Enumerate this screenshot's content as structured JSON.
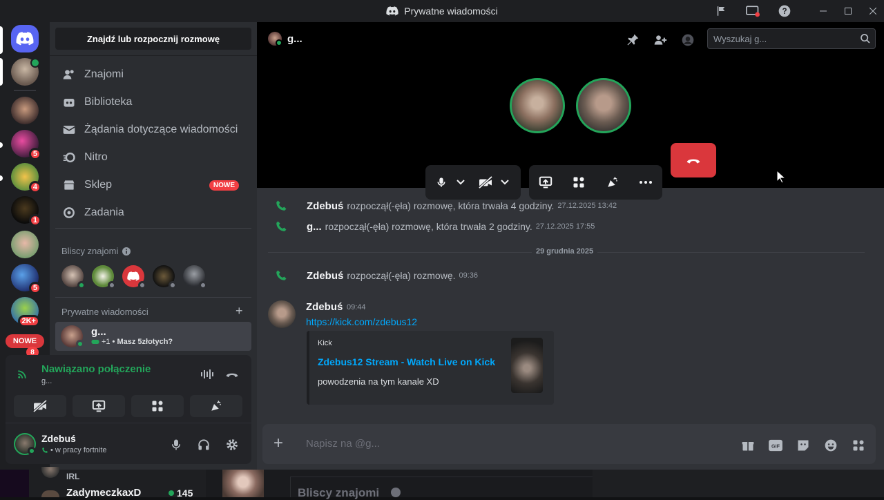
{
  "window": {
    "title": "Prywatne wiadomości"
  },
  "rail": {
    "badges": [
      "5",
      "4",
      "1",
      "5",
      "2K+"
    ],
    "new_label": "NOWE",
    "new_count": "8"
  },
  "sidebar": {
    "search_label": "Znajdź lub rozpocznij rozmowę",
    "nav": [
      {
        "label": "Znajomi",
        "icon": "friends-icon"
      },
      {
        "label": "Biblioteka",
        "icon": "library-icon"
      },
      {
        "label": "Żądania dotyczące wiadomości",
        "icon": "mail-icon"
      },
      {
        "label": "Nitro",
        "icon": "nitro-icon"
      },
      {
        "label": "Sklep",
        "icon": "shop-icon",
        "badge": "NOWE"
      },
      {
        "label": "Zadania",
        "icon": "quests-icon"
      }
    ],
    "close_friends_header": "Bliscy znajomi",
    "dm_header": "Prywatne wiadomości",
    "dm_item": {
      "name": "g...",
      "status_prefix": "+1",
      "status": "• Masz 5złotych?"
    }
  },
  "voice": {
    "status": "Nawiązano połączenie",
    "channel": "g..."
  },
  "user": {
    "name": "Zdebuś",
    "status": "• w pracy fortnite"
  },
  "header": {
    "name": "g...",
    "search_placeholder": "Wyszukaj g..."
  },
  "messages": {
    "sys1": {
      "name": "Zdebuś",
      "text": "rozpoczął(-ęła) rozmowę, która trwała 4 godziny.",
      "ts": "27.12.2025 13:42"
    },
    "sys2": {
      "name": "g...",
      "text": "rozpoczął(-ęła) rozmowę, która trwała 2 godziny.",
      "ts": "27.12.2025 17:55"
    },
    "divider": "29 grudnia 2025",
    "sys3": {
      "name": "Zdebuś",
      "text": "rozpoczął(-ęła) rozmowę.",
      "ts": "09:36"
    },
    "msg": {
      "name": "Zdebuś",
      "ts": "09:44",
      "link": "https://kick.com/zdebus12",
      "embed_provider": "Kick",
      "embed_title": "Zdebus12 Stream - Watch Live on Kick",
      "embed_desc": "powodzenia na tym kanale XD"
    }
  },
  "composer": {
    "placeholder": "Napisz na @g..."
  },
  "bottom": {
    "irl": "IRL",
    "user": "ZadymeczkaxD",
    "count": "145",
    "friends": "Bliscy znajomi"
  },
  "colors": {
    "accent": "#5865f2",
    "green": "#23a55a",
    "red": "#da373c",
    "link": "#00a8fc"
  }
}
